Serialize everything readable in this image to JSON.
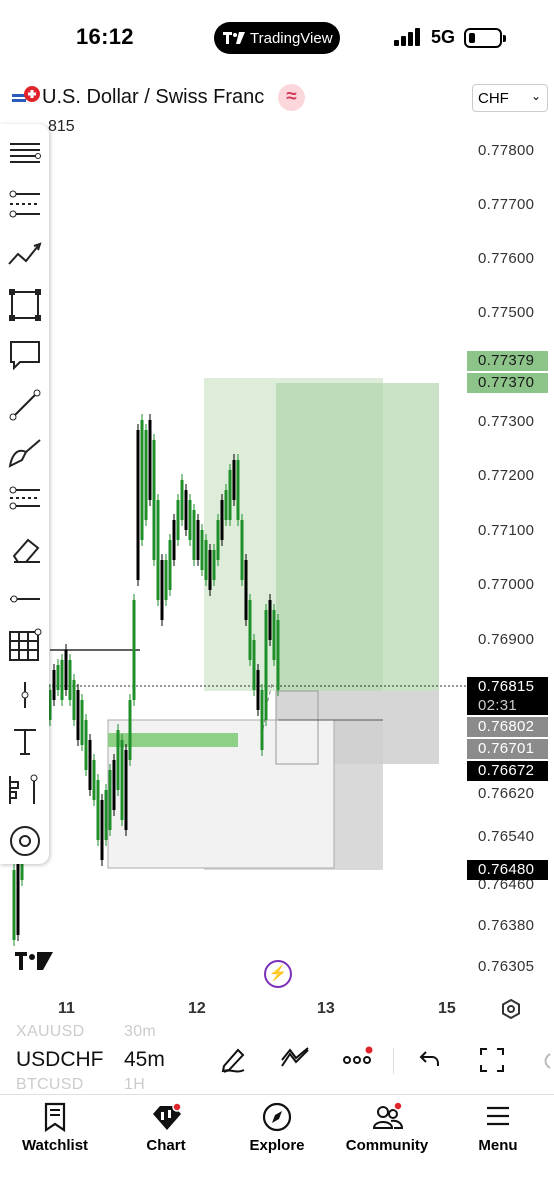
{
  "status_bar": {
    "time": "16:12",
    "app_label": "TradingView",
    "network": "5G"
  },
  "header": {
    "symbol_title": "U.S. Dollar / Swiss Franc",
    "currency": "CHF",
    "price_fragment": "815"
  },
  "price_axis": [
    "0.77800",
    "0.77700",
    "0.77600",
    "0.77500",
    "0.77300",
    "0.77200",
    "0.77100",
    "0.77000",
    "0.76900",
    "0.76620",
    "0.76540",
    "0.76460",
    "0.76380",
    "0.76305"
  ],
  "price_tags": {
    "tp_top": "0.77379",
    "tp_bottom": "0.77370",
    "last_price": "0.76815",
    "countdown": "02:31",
    "level_1": "0.76802",
    "level_2": "0.76701",
    "level_3": "0.76672",
    "level_4": "0.76480"
  },
  "time_axis": [
    "11",
    "12",
    "13",
    "15"
  ],
  "bottom_bar": {
    "symbol_above": "XAUUSD",
    "symbol": "USDCHF",
    "symbol_below": "BTCUSD",
    "interval_above": "30m",
    "interval": "45m",
    "interval_below": "1H"
  },
  "tabs": [
    "Watchlist",
    "Chart",
    "Explore",
    "Community",
    "Menu"
  ],
  "colors": {
    "up": "#1f8f2a",
    "down": "#000000",
    "long_zone": "#b7d8b2",
    "tag_green": "#8dc48a",
    "tag_grey": "#8b8b8b"
  }
}
